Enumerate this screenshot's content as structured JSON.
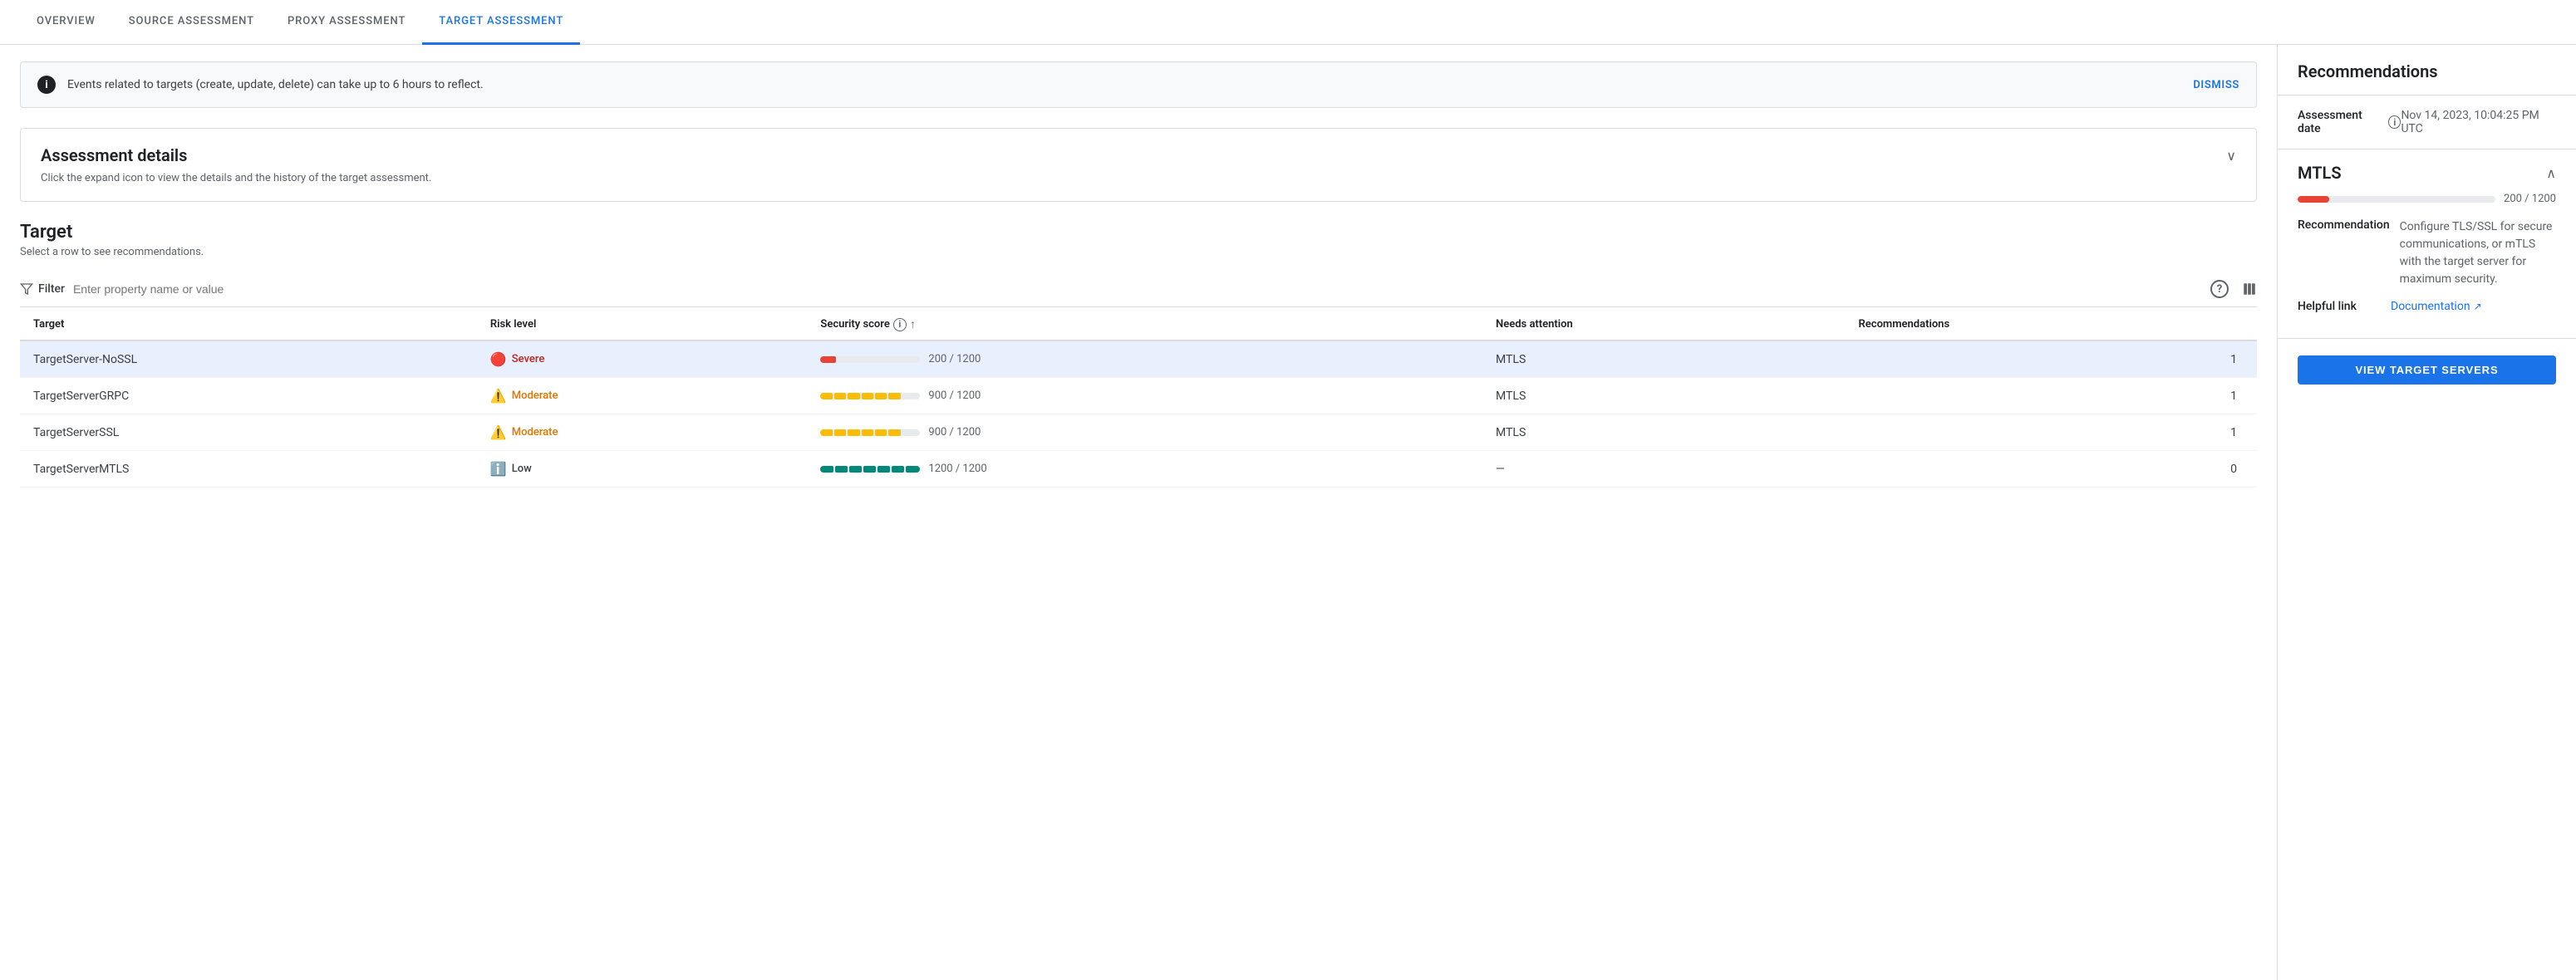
{
  "nav": {
    "tabs": [
      {
        "id": "overview",
        "label": "OVERVIEW",
        "active": false
      },
      {
        "id": "source",
        "label": "SOURCE ASSESSMENT",
        "active": false
      },
      {
        "id": "proxy",
        "label": "PROXY ASSESSMENT",
        "active": false
      },
      {
        "id": "target",
        "label": "TARGET ASSESSMENT",
        "active": true
      }
    ]
  },
  "banner": {
    "text": "Events related to targets (create, update, delete) can take up to 6 hours to reflect.",
    "dismiss_label": "DISMISS"
  },
  "assessment_details": {
    "title": "Assessment details",
    "subtitle": "Click the expand icon to view the details and the history of the target assessment."
  },
  "target_section": {
    "title": "Target",
    "subtitle": "Select a row to see recommendations.",
    "filter_placeholder": "Enter property name or value",
    "filter_label": "Filter",
    "table": {
      "columns": [
        {
          "id": "target",
          "label": "Target"
        },
        {
          "id": "risk_level",
          "label": "Risk level"
        },
        {
          "id": "security_score",
          "label": "Security score"
        },
        {
          "id": "needs_attention",
          "label": "Needs attention"
        },
        {
          "id": "recommendations",
          "label": "Recommendations"
        }
      ],
      "rows": [
        {
          "target": "TargetServer-NoSSL",
          "risk_level": "Severe",
          "risk_type": "severe",
          "score_numerator": 200,
          "score_denominator": 1200,
          "score_display": "200 / 1200",
          "bar_type": "severe",
          "needs_attention": "MTLS",
          "recommendations": "1",
          "selected": true
        },
        {
          "target": "TargetServerGRPC",
          "risk_level": "Moderate",
          "risk_type": "moderate",
          "score_numerator": 900,
          "score_denominator": 1200,
          "score_display": "900 / 1200",
          "bar_type": "moderate",
          "needs_attention": "MTLS",
          "recommendations": "1",
          "selected": false
        },
        {
          "target": "TargetServerSSL",
          "risk_level": "Moderate",
          "risk_type": "moderate",
          "score_numerator": 900,
          "score_denominator": 1200,
          "score_display": "900 / 1200",
          "bar_type": "moderate",
          "needs_attention": "MTLS",
          "recommendations": "1",
          "selected": false
        },
        {
          "target": "TargetServerMTLS",
          "risk_level": "Low",
          "risk_type": "low",
          "score_numerator": 1200,
          "score_denominator": 1200,
          "score_display": "1200 / 1200",
          "bar_type": "low",
          "needs_attention": "—",
          "recommendations": "0",
          "selected": false
        }
      ]
    }
  },
  "right_panel": {
    "title": "Recommendations",
    "assessment_date_label": "Assessment date",
    "assessment_date_value": "Nov 14, 2023, 10:04:25 PM UTC",
    "mtls": {
      "title": "MTLS",
      "score_display": "200 / 1200",
      "recommendation_label": "Recommendation",
      "recommendation_text": "Configure TLS/SSL for secure communications, or mTLS with the target server for maximum security.",
      "helpful_link_label": "Helpful link",
      "helpful_link_text": "Documentation",
      "helpful_link_url": "#"
    },
    "view_button_label": "VIEW TARGET SERVERS"
  }
}
